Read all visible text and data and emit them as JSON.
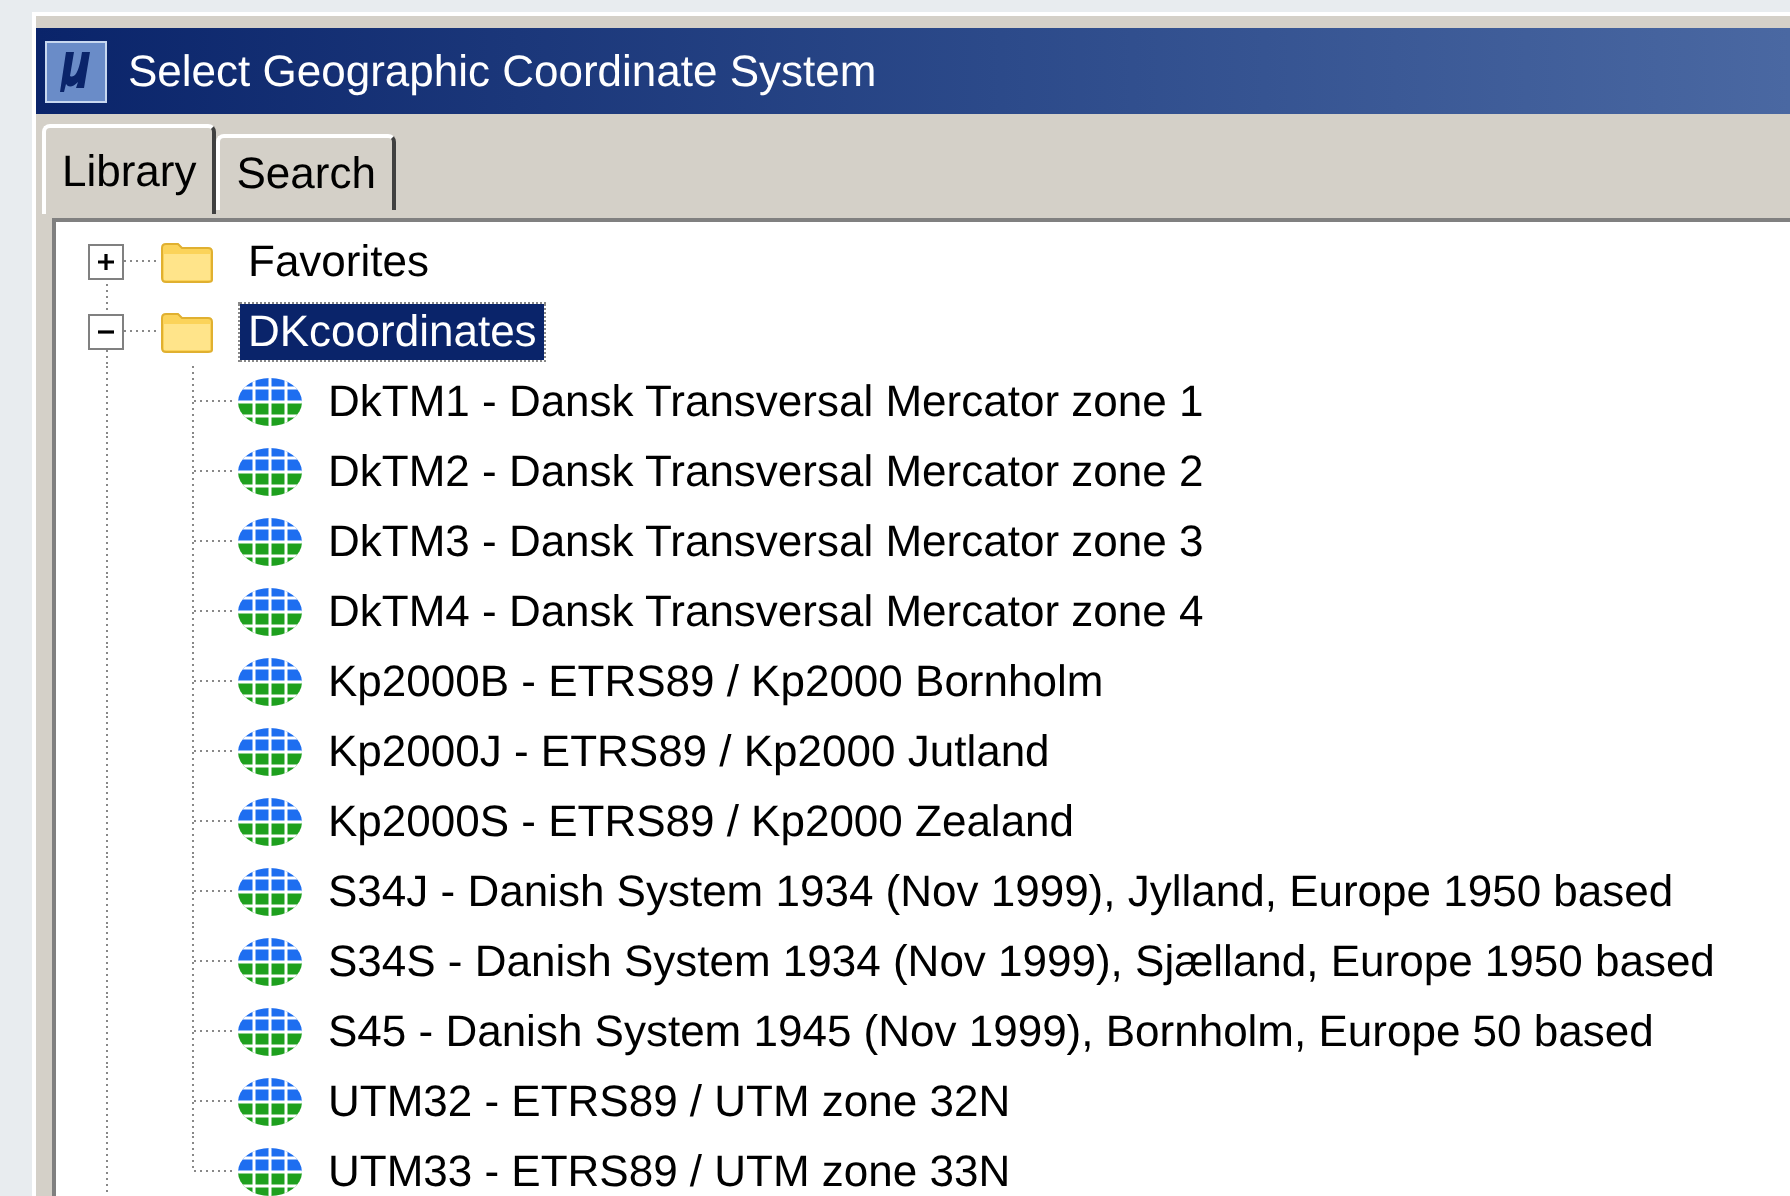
{
  "window": {
    "title": "Select Geographic Coordinate System"
  },
  "tabs": [
    {
      "label": "Library",
      "selected": true
    },
    {
      "label": "Search",
      "selected": false
    }
  ],
  "tree": [
    {
      "label": "Favorites",
      "kind": "folder",
      "expanded": false,
      "selected": false
    },
    {
      "label": "DKcoordinates",
      "kind": "folder",
      "expanded": true,
      "selected": true,
      "children": [
        {
          "label": "DkTM1 - Dansk Transversal Mercator zone 1",
          "kind": "system",
          "selected": false
        },
        {
          "label": "DkTM2 - Dansk Transversal Mercator zone 2",
          "kind": "system",
          "selected": false
        },
        {
          "label": "DkTM3 - Dansk Transversal Mercator zone 3",
          "kind": "system",
          "selected": false
        },
        {
          "label": "DkTM4 - Dansk Transversal Mercator zone 4",
          "kind": "system",
          "selected": false
        },
        {
          "label": "Kp2000B - ETRS89 / Kp2000 Bornholm",
          "kind": "system",
          "selected": false
        },
        {
          "label": "Kp2000J - ETRS89 / Kp2000 Jutland",
          "kind": "system",
          "selected": false
        },
        {
          "label": "Kp2000S - ETRS89 / Kp2000 Zealand",
          "kind": "system",
          "selected": false
        },
        {
          "label": "S34J - Danish System 1934 (Nov 1999), Jylland, Europe 1950 based",
          "kind": "system",
          "selected": false
        },
        {
          "label": "S34S - Danish System 1934 (Nov 1999), Sjælland, Europe 1950 based",
          "kind": "system",
          "selected": false
        },
        {
          "label": "S45 - Danish System 1945 (Nov 1999), Bornholm, Europe 50 based",
          "kind": "system",
          "selected": false
        },
        {
          "label": "UTM32 - ETRS89 / UTM zone 32N",
          "kind": "system",
          "selected": false
        },
        {
          "label": "UTM33 - ETRS89 / UTM zone 33N",
          "kind": "system",
          "selected": false
        }
      ]
    }
  ]
}
